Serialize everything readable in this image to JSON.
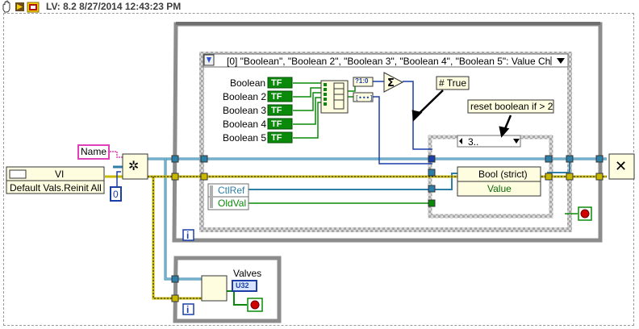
{
  "title_bar": {
    "version_text": "LV: 8.2 8/27/2014 12:43:23 PM",
    "icons": [
      "hand-icon",
      "labview-run-icon",
      "labview-logo-icon"
    ]
  },
  "left_section": {
    "name_constant": "Name",
    "vi_ref_class": "VI",
    "vi_ref_method": "Default Vals.Reinit All",
    "zero_constant": "0"
  },
  "event_structure": {
    "selector": "[0] \"Boolean\", \"Boolean 2\", \"Boolean 3\", \"Boolean 4\", \"Boolean 5\": Value Ch",
    "booleans": [
      "Boolean",
      "Boolean 2",
      "Boolean 3",
      "Boolean 4",
      "Boolean 5"
    ],
    "bool_terminal": "TF",
    "comment_true": "# True",
    "comment_reset": "reset boolean if > 2",
    "case_selector": "3..",
    "event_data": [
      "CtlRef",
      "OldVal"
    ],
    "property_node_class": "Bool (strict)",
    "property_node_prop": "Value",
    "to_number": "?1:0",
    "iteration": "i"
  },
  "lower_loop": {
    "label": "Valves",
    "indicator_type": "U32",
    "iteration": "i"
  },
  "colors": {
    "refnum_wire": "#2e7fa8",
    "error_wire": "#c8b800",
    "bool_wire": "#0a8a0a",
    "num_wire": "#1a3fa8",
    "structure_gray": "#8c8c8c"
  }
}
